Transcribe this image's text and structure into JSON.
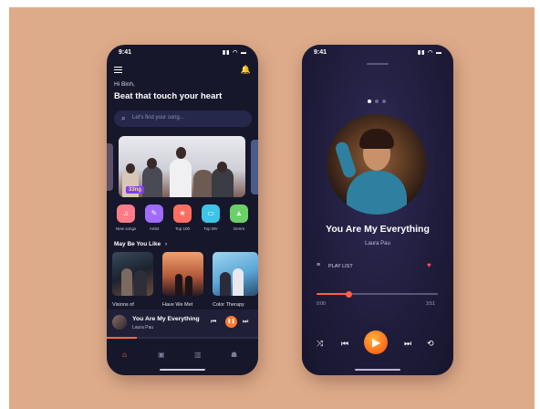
{
  "left_phone": {
    "status_time": "9:41",
    "status_icons": "▮▮ ◠ ▬",
    "greeting": "Hi Binh,",
    "headline": "Beat that touch your heart",
    "search": {
      "placeholder": "Let's find your song..."
    },
    "banner": {
      "tag": "33ng"
    },
    "categories": [
      {
        "label": "New songs",
        "icon": "music-note",
        "color": "#ff7c88",
        "glyph": "♫"
      },
      {
        "label": "Artist",
        "icon": "microphone",
        "color": "#a06bff",
        "glyph": "🎤"
      },
      {
        "label": "Top 100",
        "icon": "star",
        "color": "#ff6f61",
        "glyph": "★"
      },
      {
        "label": "Top MV",
        "icon": "monitor",
        "color": "#3ec4e6",
        "glyph": "▭"
      },
      {
        "label": "Genre",
        "icon": "shapes",
        "color": "#6bd06a",
        "glyph": "▲"
      }
    ],
    "section_title": "May Be You Like",
    "section_chevron": "›",
    "cards": [
      {
        "label": "Visions of"
      },
      {
        "label": "Have We Met"
      },
      {
        "label": "Color Therapy"
      }
    ],
    "mini_player": {
      "title": "You Are My Everything",
      "artist": "Laura Pau",
      "progress": 0.2
    },
    "nav": [
      "home-icon",
      "library-icon",
      "stats-icon",
      "profile-icon"
    ]
  },
  "right_phone": {
    "status_time": "9:41",
    "status_icons": "▮▮ ◠ ▬",
    "song_title": "You Are My Everything",
    "artist": "Laura Pau",
    "playlist_label": "PLAY LIST",
    "time_elapsed": "0:00",
    "time_total": "3:51",
    "progress": 0.26,
    "accent_color": "#ff5f46"
  }
}
